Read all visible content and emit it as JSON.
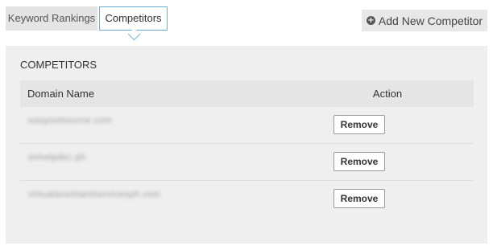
{
  "tabs": [
    {
      "label": "Keyword Rankings",
      "active": false
    },
    {
      "label": "Competitors",
      "active": true
    }
  ],
  "add_button": {
    "label": "Add New Competitor",
    "icon": "plus-circle-icon"
  },
  "panel": {
    "title": "COMPETITORS",
    "columns": [
      "Domain Name",
      "Action"
    ],
    "rows": [
      {
        "domain": "easyoutsource.com",
        "action_label": "Remove"
      },
      {
        "domain": "onhelpdsc.ph",
        "action_label": "Remove"
      },
      {
        "domain": "virtualassistantservicesph.com",
        "action_label": "Remove"
      }
    ]
  },
  "colors": {
    "tab_active_border": "#6ab0d6",
    "panel_bg": "#efefef"
  }
}
